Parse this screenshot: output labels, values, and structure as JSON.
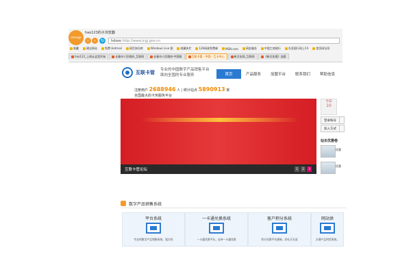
{
  "browser": {
    "logo_text": "orange",
    "title": "hao123的子浏览器",
    "home_label": "hdsoo",
    "address": "http://www.jcgj.gov.cn",
    "bookmarks": [
      "收藏",
      "建议网站",
      "免费 Hotmail",
      "网页快讯库",
      "Windows Live 图",
      "收藏夹栏",
      "126网易免费邮",
      "MSN.com",
      "网金服务",
      "中国工商银行",
      "东亚银行网上CA",
      "首页网址导"
    ],
    "tabs": [
      {
        "label": "hao123_上网从这里开始",
        "active": false
      },
      {
        "label": "长春市人民政府_互联网",
        "active": false
      },
      {
        "label": "长春市人民政府-中国政",
        "active": false
      },
      {
        "label": "互联卡管 - 中国 - 互卡中心",
        "active": true
      },
      {
        "label": "新文化网_互联网",
        "active": false
      },
      {
        "label": "《新文化报》连载",
        "active": false
      }
    ]
  },
  "site": {
    "name": "互联卡管",
    "slogan_line1": "专业的中国数字产品销售平台",
    "slogan_line2": "面向全国的专业服务",
    "nav": [
      {
        "label": "首页",
        "active": true
      },
      {
        "label": "产品服务",
        "active": false
      },
      {
        "label": "加盟平台",
        "active": false
      },
      {
        "label": "联系我们",
        "active": false
      },
      {
        "label": "帮助信息",
        "active": false
      }
    ],
    "stats_prefix": "注册用户",
    "stats_users": "2688946",
    "stats_mid": "人 | 统计站点",
    "stats_sites": "5890913",
    "stats_suffix": "家",
    "stats_line2": "全国最大的卡务服务平台"
  },
  "banner": {
    "caption": "互联卡管论坛",
    "pages": [
      "1",
      "2",
      "3"
    ],
    "active_page": "3"
  },
  "side": {
    "date_label": "今日",
    "date_num": "10",
    "btn_login": "登录帐号",
    "btn_join": "加入方式",
    "heading": "站长优惠卷",
    "items": [
      "优惠",
      "优惠"
    ]
  },
  "products": {
    "title": "数字产品销售系统",
    "cards": [
      {
        "title": "平台系统",
        "desc": "专业的数字产品销售系统，强大的"
      },
      {
        "title": "一卡通兑换系统",
        "desc": "一卡通兑换平台，支持一卡通兑换"
      },
      {
        "title": "客户积分系统",
        "desc": "积分兑换平台更新，好礼天天送"
      },
      {
        "title": "网站供",
        "desc": "方便产品供货系统，"
      }
    ]
  },
  "colors": {
    "accent": "#2b7ad2",
    "banner": "#d41e23",
    "highlight": "#f08a00"
  }
}
